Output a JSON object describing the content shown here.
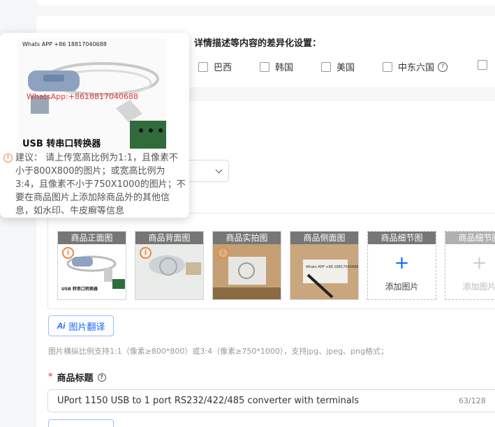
{
  "region": {
    "title": "详情描述等内容的差异化设置：",
    "options": [
      {
        "label": "巴西"
      },
      {
        "label": "韩国"
      },
      {
        "label": "美国"
      },
      {
        "label": "中东六国"
      }
    ]
  },
  "images": {
    "slots": [
      {
        "label": "商品正面图",
        "status": "warning"
      },
      {
        "label": "商品背面图",
        "status": "warning"
      },
      {
        "label": "商品实拍图",
        "status": "warning"
      },
      {
        "label": "商品侧面图",
        "status": "ok"
      },
      {
        "label": "商品细节图",
        "add_text": "添加图片"
      },
      {
        "label": "商品细节图",
        "add_text": "添加图片"
      }
    ],
    "translate_button": "图片翻译",
    "hint": "图片横纵比例支持1:1（像素≥800*800）或3:4（像素≥750*1000），支持jpg、jpeg、png格式；"
  },
  "title_field": {
    "label": "商品标题",
    "value": "UPort 1150 USB to 1 port RS232/422/485 converter with terminals",
    "counter": "63/128"
  },
  "popover": {
    "watermark_top": "Whats APP +86 18817040688",
    "watermark_red": "WhatsApp:+8618817040688",
    "caption": "USB 转串口转换器",
    "advice": "建议： 请上传宽高比例为1:1，且像素不小于800X800的图片；或宽高比例为3:4，且像素不小于750X1000的图片；不要在商品图片上添加除商品外的其他信息，如水印、牛皮癣等信息"
  },
  "colors": {
    "accent": "#1a66ff",
    "warning": "#f0873e",
    "required": "#f5222d"
  }
}
